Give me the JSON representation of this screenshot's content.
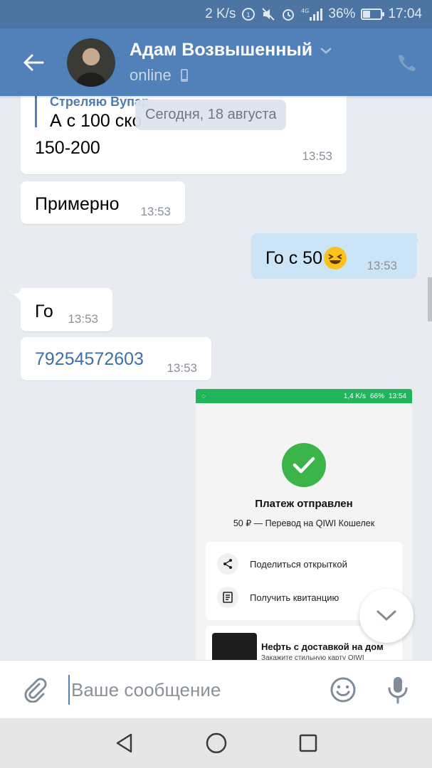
{
  "status_bar": {
    "speed": "2 K/s",
    "network": "4G",
    "battery": "36%",
    "battery_level": 0.36,
    "time": "17:04"
  },
  "header": {
    "name": "Адам Возвышенный",
    "status": "online"
  },
  "chat": {
    "date_separator": "Сегодня, 18 августа",
    "messages": [
      {
        "reply_author": "Стреляю Вупар",
        "reply_text": "А с 100 ско",
        "text": "150-200",
        "time": "13:53"
      },
      {
        "text": "Примерно",
        "time": "13:53"
      },
      {
        "text": "Го с 50",
        "emoji": "😆",
        "time": "13:53"
      },
      {
        "text": "Го",
        "time": "13:53"
      },
      {
        "text": "79254572603",
        "time": "13:53"
      }
    ],
    "attachment": {
      "status_speed": "1,4 K/s",
      "status_battery": "66%",
      "status_time": "13:54",
      "title": "Платеж отправлен",
      "subtitle": "50 ₽ — Перевод на QIWI Кошелек",
      "actions": [
        "Поделиться открыткой",
        "Получить квитанцию"
      ],
      "promo_title": "Нефть с доставкой на дом",
      "promo_subtitle": "Закажите стильную карту QIWI"
    }
  },
  "input": {
    "placeholder": "Ваше сообщение"
  },
  "colors": {
    "header": "#5181b8",
    "outgoing": "#cce4f7",
    "qiwi_green": "#3bb54a"
  }
}
